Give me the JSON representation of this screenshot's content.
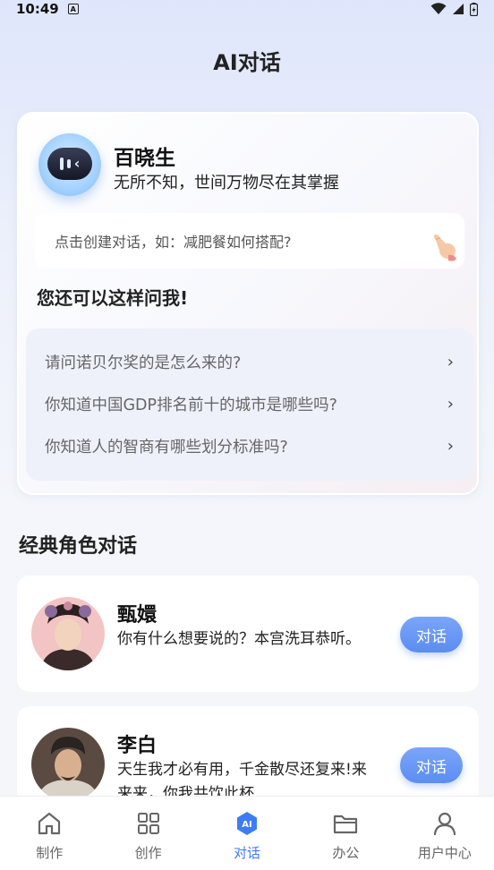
{
  "status_bar": {
    "time": "10:49",
    "badge": "A"
  },
  "header": {
    "title": "AI对话"
  },
  "assistant": {
    "name": "百晓生",
    "tagline": "无所不知，世间万物尽在其掌握",
    "input_placeholder": "点击创建对话，如：减肥餐如何搭配?",
    "suggest_title": "您还可以这样问我!",
    "suggestions": [
      "请问诺贝尔奖的是怎么来的?",
      "你知道中国GDP排名前十的城市是哪些吗?",
      "你知道人的智商有哪些划分标准吗?"
    ]
  },
  "classic_section": {
    "title": "经典角色对话",
    "roles": [
      {
        "name": "甄嬛",
        "desc": "你有什么想要说的？本宫洗耳恭听。",
        "button": "对话"
      },
      {
        "name": "李白",
        "desc": "天生我才必有用，千金散尽还复来!来来来，你我共饮此杯",
        "button": "对话"
      }
    ]
  },
  "tabs": [
    {
      "label": "制作",
      "icon": "home-icon"
    },
    {
      "label": "创作",
      "icon": "grid-icon"
    },
    {
      "label": "对话",
      "icon": "ai-icon"
    },
    {
      "label": "办公",
      "icon": "folder-icon"
    },
    {
      "label": "用户中心",
      "icon": "user-icon"
    }
  ],
  "colors": {
    "accent": "#3f7cf3",
    "button": "#5b8cf2"
  }
}
